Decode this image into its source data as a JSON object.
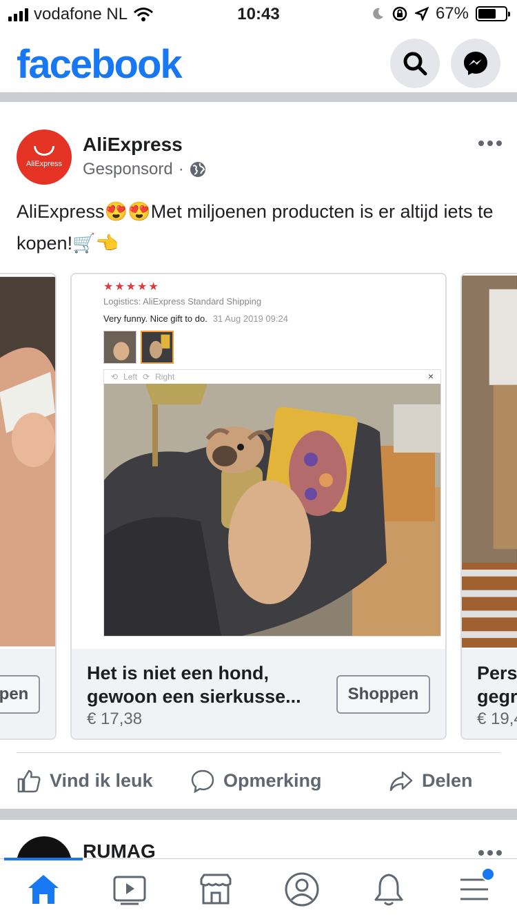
{
  "status": {
    "carrier": "vodafone NL",
    "time": "10:43",
    "battery": "67%",
    "battery_level": 0.67
  },
  "header": {
    "logo": "facebook",
    "search_icon": "search-icon",
    "messenger_icon": "messenger-icon"
  },
  "post": {
    "page_name": "AliExpress",
    "avatar_text": "AliExpress",
    "sponsored": "Gesponsord",
    "sponsored_sep": "·",
    "text": "AliExpress😍😍Met miljoenen producten is er altijd iets te kopen!🛒👈",
    "carousel": {
      "prev_card": {
        "shop_label": "Shoppen"
      },
      "main_card": {
        "title": "Het is niet een hond, gewoon een sierkusse...",
        "price": "€ 17,38",
        "shop_label": "Shoppen",
        "review": {
          "stars": "★★★★★",
          "logistics": "Logistics: AliExpress Standard Shipping",
          "comment": "Very funny. Nice gift to do.",
          "date": "31 Aug 2019 09:24",
          "viewer_left": "Left",
          "viewer_right": "Right",
          "viewer_close": "×"
        }
      },
      "next_card": {
        "title": "Pers gegr",
        "price": "€ 19,4"
      }
    },
    "actions": {
      "like": "Vind ik leuk",
      "comment": "Opmerking",
      "share": "Delen"
    }
  },
  "next_post": {
    "page_name": "RUMAG"
  },
  "tabs": [
    {
      "name": "home",
      "active": true
    },
    {
      "name": "watch"
    },
    {
      "name": "marketplace"
    },
    {
      "name": "profile"
    },
    {
      "name": "notifications"
    },
    {
      "name": "menu",
      "badge": true
    }
  ],
  "colors": {
    "brand": "#1877f2",
    "aliexpress": "#e43225"
  }
}
